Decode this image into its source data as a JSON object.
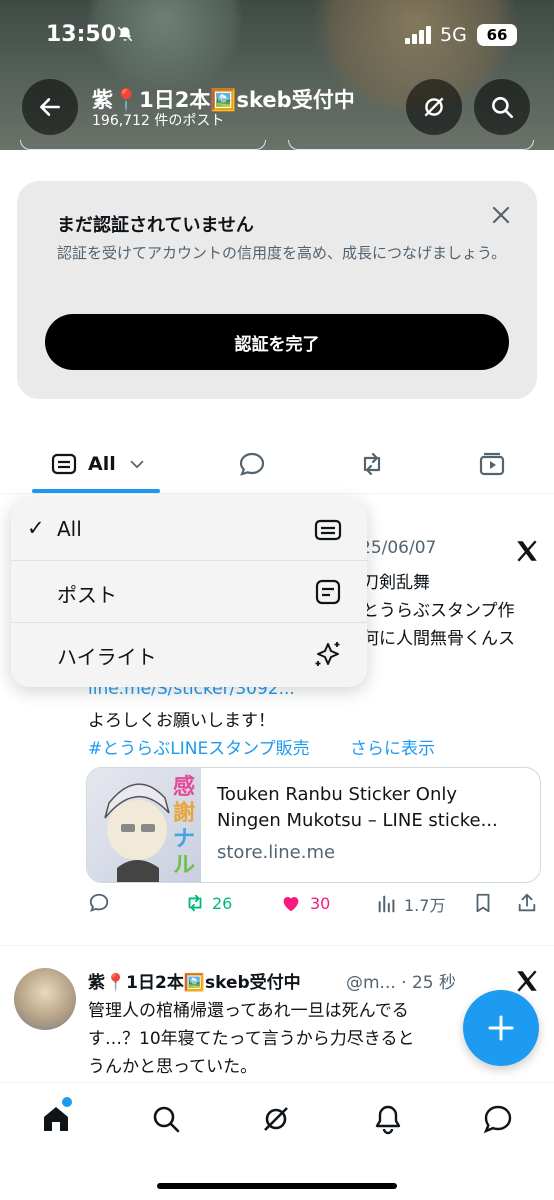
{
  "status_bar": {
    "time": "13:50",
    "network": "5G",
    "battery": "66"
  },
  "header": {
    "title": "紫📍1日2本🖼️skeb受付中",
    "subtitle": "196,712 件のポスト"
  },
  "verify_card": {
    "title": "まだ認証されていません",
    "description": "認証を受けてアカウントの信用度を高め、成長につなげましょう。",
    "button_label": "認証を完了"
  },
  "tabs": {
    "all_label": "All"
  },
  "dropdown": {
    "items": [
      {
        "label": "All",
        "checked": true,
        "icon": "feed-icon"
      },
      {
        "label": "ポスト",
        "checked": false,
        "icon": "post-icon"
      },
      {
        "label": "ハイライト",
        "checked": false,
        "icon": "sparkle-icon"
      }
    ],
    "check": "✓"
  },
  "tweet1": {
    "date_fragment": "25/06/07",
    "line1_fragment": "刀剣乱舞",
    "line2_fragment": "とうらぶスタンプ作",
    "line3_fragment": "何に人間無骨くんス",
    "link_fragment": "line.me/S/sticker/3092...",
    "line5": "よろしくお願いします！",
    "hashtag": "#とうらぶLINEスタンプ販売",
    "show_more": "さらに表示",
    "card": {
      "title1": "Touken Ranbu Sticker Only",
      "title2": "Ningen Mukotsu – LINE sticke...",
      "domain": "store.line.me"
    },
    "actions": {
      "reposts": "26",
      "likes": "30",
      "views": "1.7万"
    }
  },
  "tweet2": {
    "name": "紫📍1日2本🖼️skeb受付中",
    "handle_time": "@m... · 25 秒",
    "line1": "管理人の棺桶帰還ってあれ一旦は死んでる",
    "line2": "す…？10年寝てたって言うから力尽きると",
    "line3": "うんかと思っていた。"
  },
  "colors": {
    "accent": "#1d9bf0",
    "repost": "#00ba7c",
    "like": "#f91880"
  }
}
